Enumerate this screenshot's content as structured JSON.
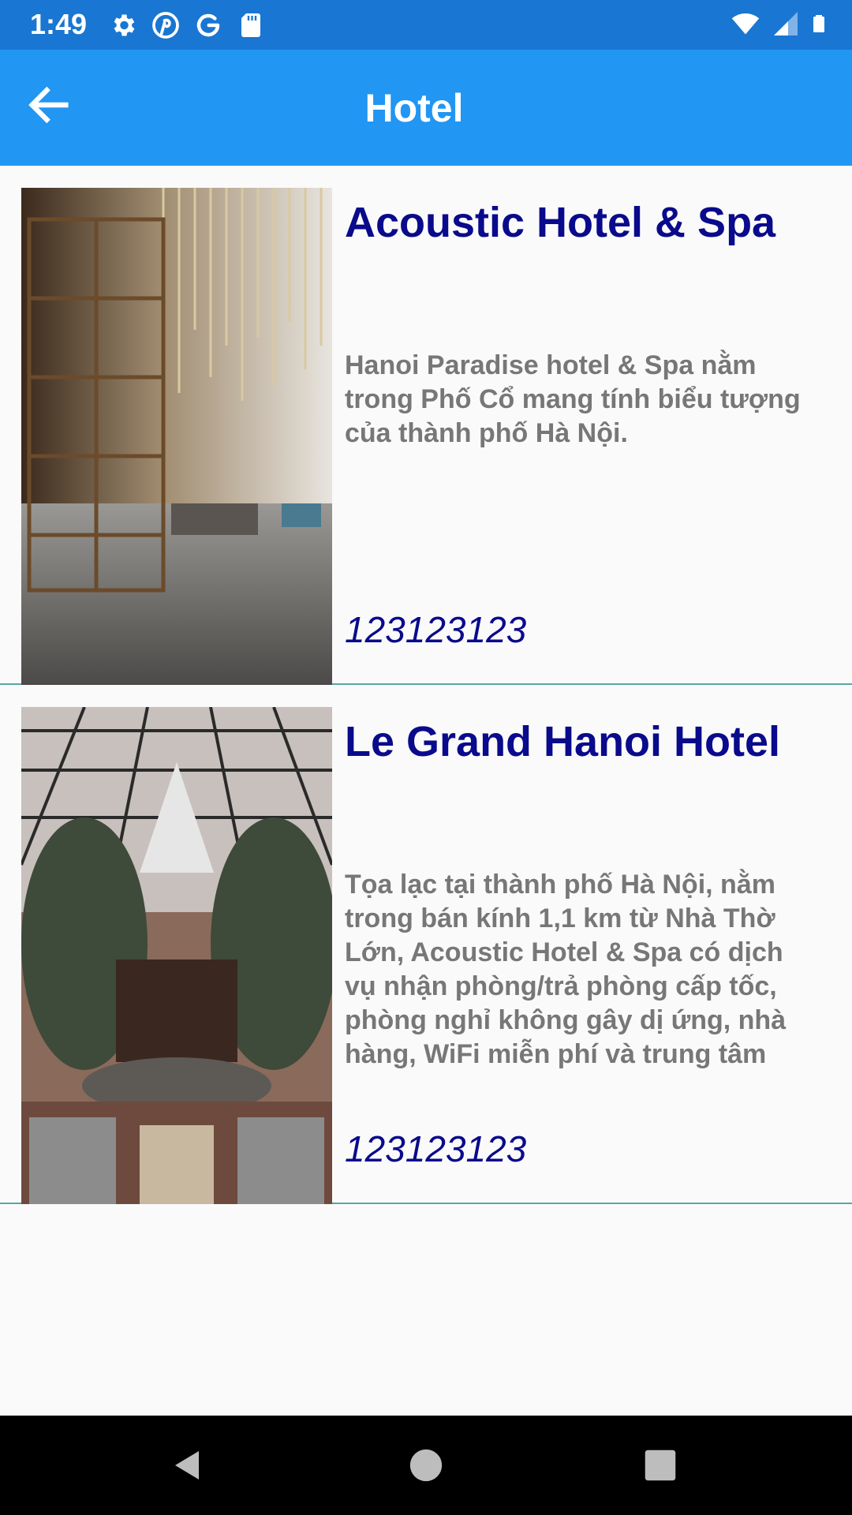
{
  "status_bar": {
    "time": "1:49",
    "left_icons": [
      "settings-icon",
      "pinterest-icon",
      "google-icon",
      "sd-card-icon"
    ],
    "right_icons": [
      "wifi-icon",
      "signal-icon",
      "battery-icon"
    ],
    "color": "#1976d2"
  },
  "app_bar": {
    "title": "Hotel",
    "back_icon": "arrow-back-icon",
    "color": "#2196f3"
  },
  "hotels": [
    {
      "name": "Acoustic Hotel & Spa",
      "description": "Hanoi Paradise hotel & Spa nằm trong Phố Cổ mang tính biểu tượng của thành phố Hà Nội.",
      "phone": "123123123",
      "image": "hotel-lobby-photo"
    },
    {
      "name": "Le Grand Hanoi Hotel",
      "description": "Tọa lạc tại thành phố Hà Nội, nằm trong bán kính 1,1 km từ Nhà Thờ Lớn, Acoustic Hotel & Spa có dịch vụ nhận phòng/trả phòng cấp tốc, phòng nghỉ không gây dị ứng, nhà hàng, WiFi miễn phí và trung tâm",
      "phone": "123123123",
      "image": "hotel-atrium-photo"
    }
  ],
  "colors": {
    "title_text": "#0a0a8c",
    "description_text": "#777777",
    "divider": "#5aa6a6"
  },
  "nav_bar": {
    "buttons": [
      "back-triangle-icon",
      "home-circle-icon",
      "recents-square-icon"
    ]
  }
}
